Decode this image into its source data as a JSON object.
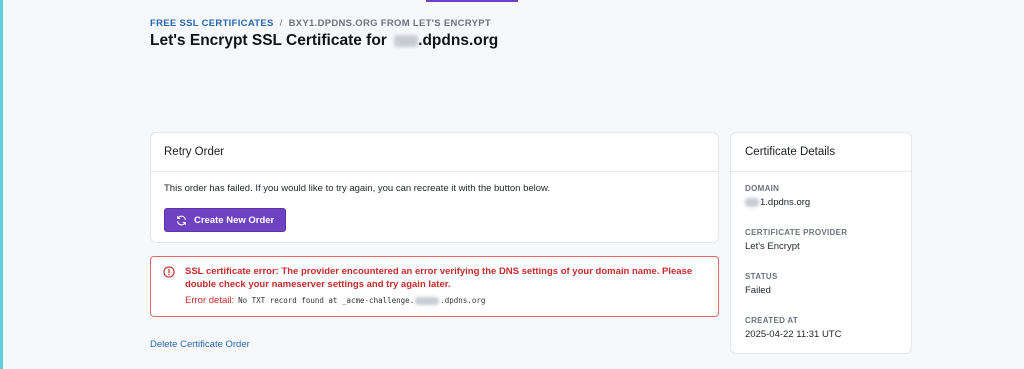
{
  "breadcrumb": {
    "root": "FREE SSL CERTIFICATES",
    "separator": "/",
    "current": "BXY1.DPDNS.ORG FROM LET'S ENCRYPT"
  },
  "page": {
    "title_prefix": "Let's Encrypt SSL Certificate for ",
    "title_suffix": ".dpdns.org"
  },
  "retry": {
    "heading": "Retry Order",
    "message": "This order has failed. If you would like to try again, you can recreate it with the button below.",
    "button_label": "Create New Order"
  },
  "error": {
    "message": "SSL certificate error: The provider encountered an error verifying the DNS settings of your domain name. Please double check your nameserver settings and try again later.",
    "detail_label": "Error detail:",
    "detail_code_prefix": "No TXT record found at _acme-challenge.",
    "detail_code_suffix": ".dpdns.org"
  },
  "delete_link": "Delete Certificate Order",
  "details": {
    "heading": "Certificate Details",
    "items": [
      {
        "label": "DOMAIN",
        "value_prefix": "",
        "value": "1.dpdns.org"
      },
      {
        "label": "CERTIFICATE PROVIDER",
        "value": "Let's Encrypt"
      },
      {
        "label": "STATUS",
        "value": "Failed"
      },
      {
        "label": "CREATED AT",
        "value": "2025-04-22 11:31 UTC"
      }
    ]
  },
  "colors": {
    "accent": "#6f42c1",
    "link": "#2866b1",
    "error": "#c62c2c",
    "background": "#f7f8fc"
  },
  "icons": {
    "refresh": "refresh-icon",
    "error": "alert-circle-icon"
  }
}
